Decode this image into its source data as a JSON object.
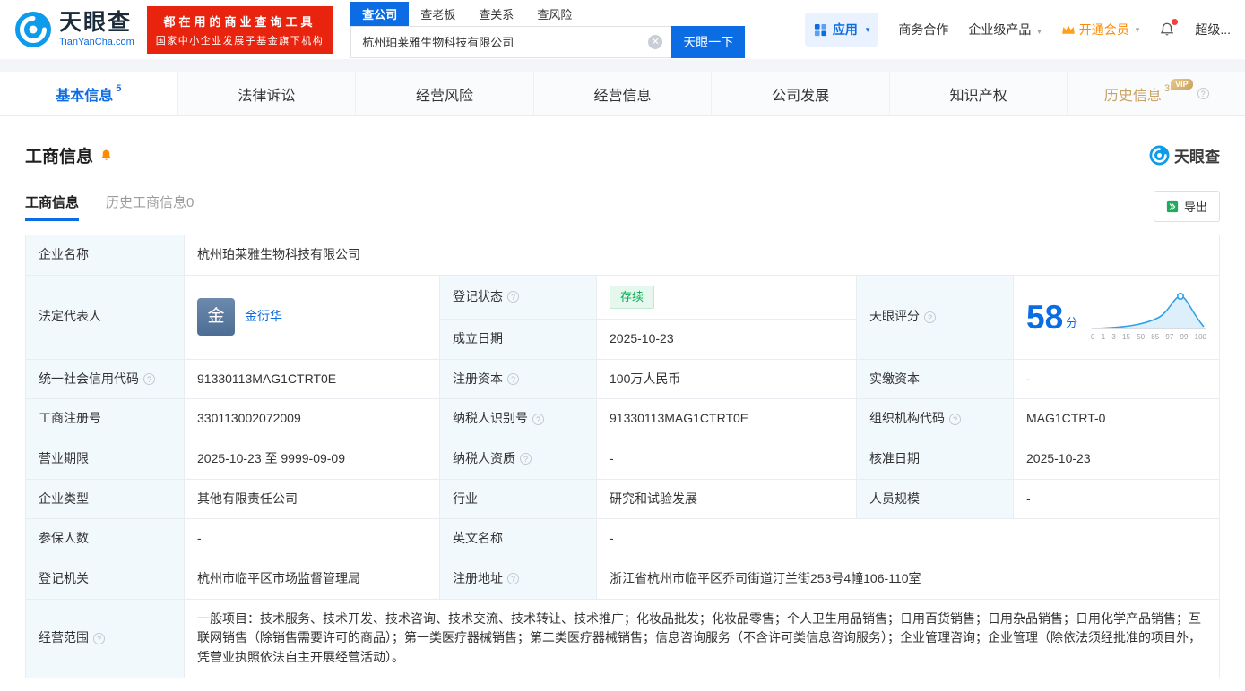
{
  "colors": {
    "brand_blue": "#0b6ce3",
    "logo_blue": "#0d9bec",
    "promo_red": "#e8240f",
    "vip_gold": "#c9a267",
    "status_green": "#00b152",
    "label_cell_bg": "#f2f9fd",
    "orange_accent": "#ff8a00"
  },
  "header": {
    "logo": {
      "brand": "天眼查",
      "domain": "TianYanCha.com"
    },
    "promo": {
      "line1": "都在用的商业查询工具",
      "line2": "国家中小企业发展子基金旗下机构"
    },
    "search_tabs": [
      {
        "label": "查公司"
      },
      {
        "label": "查老板"
      },
      {
        "label": "查关系"
      },
      {
        "label": "查风险"
      }
    ],
    "search": {
      "value": "杭州珀莱雅生物科技有限公司",
      "button": "天眼一下",
      "clear": "✕"
    },
    "nav": {
      "apps": "应用",
      "cooperation": "商务合作",
      "enterprise": "企业级产品",
      "vip": "开通会员",
      "super": "超级..."
    }
  },
  "main_tabs": [
    {
      "label": "基本信息",
      "count": "5"
    },
    {
      "label": "法律诉讼"
    },
    {
      "label": "经营风险"
    },
    {
      "label": "经营信息"
    },
    {
      "label": "公司发展"
    },
    {
      "label": "知识产权"
    },
    {
      "label": "历史信息",
      "count": "3",
      "vip_badge": "VIP"
    }
  ],
  "section": {
    "title": "工商信息",
    "watermark": "天眼查",
    "subtabs": [
      {
        "label": "工商信息"
      },
      {
        "label": "历史工商信息0"
      }
    ],
    "export": "导出"
  },
  "score_chart": {
    "score": "58",
    "unit": "分",
    "axis_labels": "0 1 3 15 50 85 97 99 100"
  },
  "fields": {
    "company_name": {
      "label": "企业名称",
      "value": "杭州珀莱雅生物科技有限公司"
    },
    "legal_rep": {
      "label": "法定代表人",
      "avatar": "金",
      "name": "金衍华"
    },
    "reg_status": {
      "label": "登记状态",
      "value": "存续"
    },
    "establish_date": {
      "label": "成立日期",
      "value": "2025-10-23"
    },
    "score": {
      "label": "天眼评分"
    },
    "credit_code": {
      "label": "统一社会信用代码",
      "value": "91330113MAG1CTRT0E"
    },
    "reg_capital": {
      "label": "注册资本",
      "value": "100万人民币"
    },
    "paid_capital": {
      "label": "实缴资本",
      "value": "-"
    },
    "reg_number": {
      "label": "工商注册号",
      "value": "330113002072009"
    },
    "taxpayer_id": {
      "label": "纳税人识别号",
      "value": "91330113MAG1CTRT0E"
    },
    "org_code": {
      "label": "组织机构代码",
      "value": "MAG1CTRT-0"
    },
    "business_term": {
      "label": "营业期限",
      "value": "2025-10-23 至 9999-09-09"
    },
    "taxpayer_quality": {
      "label": "纳税人资质",
      "value": "-"
    },
    "approval_date": {
      "label": "核准日期",
      "value": "2025-10-23"
    },
    "company_type": {
      "label": "企业类型",
      "value": "其他有限责任公司"
    },
    "industry": {
      "label": "行业",
      "value": "研究和试验发展"
    },
    "staff_size": {
      "label": "人员规模",
      "value": "-"
    },
    "insured_count": {
      "label": "参保人数",
      "value": "-"
    },
    "english_name": {
      "label": "英文名称",
      "value": "-"
    },
    "reg_authority": {
      "label": "登记机关",
      "value": "杭州市临平区市场监督管理局"
    },
    "reg_address": {
      "label": "注册地址",
      "value": "浙江省杭州市临平区乔司街道汀兰街253号4幢106-110室"
    },
    "business_scope": {
      "label": "经营范围",
      "value": "一般项目：技术服务、技术开发、技术咨询、技术交流、技术转让、技术推广；化妆品批发；化妆品零售；个人卫生用品销售；日用百货销售；日用杂品销售；日用化学产品销售；互联网销售（除销售需要许可的商品）；第一类医疗器械销售；第二类医疗器械销售；信息咨询服务（不含许可类信息咨询服务）；企业管理咨询；企业管理（除依法须经批准的项目外，凭营业执照依法自主开展经营活动）。"
    }
  }
}
